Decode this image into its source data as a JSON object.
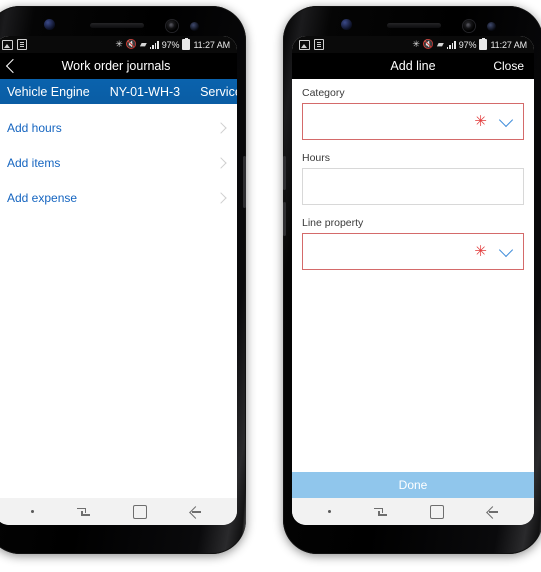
{
  "status_bar": {
    "icons_left": [
      "image-icon",
      "document-icon"
    ],
    "icons_right": [
      "bluetooth-icon",
      "mute-icon",
      "wifi-icon",
      "signal-icon"
    ],
    "battery_percent": "97%",
    "time": "11:27 AM"
  },
  "left_phone": {
    "app_bar": {
      "back_icon": "back-chevron-icon",
      "title": "Work order journals"
    },
    "record_bar": {
      "fields": [
        "Vehicle Engine",
        "NY-01-WH-3",
        "Service"
      ]
    },
    "list": {
      "items": [
        {
          "label": "Add hours",
          "chevron": "chevron-right-icon"
        },
        {
          "label": "Add items",
          "chevron": "chevron-right-icon"
        },
        {
          "label": "Add expense",
          "chevron": "chevron-right-icon"
        }
      ]
    }
  },
  "right_phone": {
    "app_bar": {
      "title": "Add line",
      "close_label": "Close"
    },
    "form": {
      "fields": [
        {
          "label": "Category",
          "value": "",
          "required": true,
          "asterisk": "✳",
          "chevron": "chevron-down-icon",
          "type": "lookup"
        },
        {
          "label": "Hours",
          "value": "",
          "required": false,
          "type": "text"
        },
        {
          "label": "Line property",
          "value": "",
          "required": true,
          "asterisk": "✳",
          "chevron": "chevron-down-icon",
          "type": "lookup"
        }
      ]
    },
    "done_button": {
      "label": "Done",
      "enabled": false
    }
  },
  "nav_bar": {
    "buttons": [
      "dot-indicator-icon",
      "recents-icon",
      "home-icon",
      "back-icon"
    ]
  },
  "colors": {
    "record_bar_blue": "#0a5fa8",
    "link_blue": "#1565c0",
    "required_red": "#d46a6a",
    "asterisk_red": "#e23b3b",
    "chevron_blue": "#3f8ddb",
    "done_blue": "#90c6ec"
  }
}
